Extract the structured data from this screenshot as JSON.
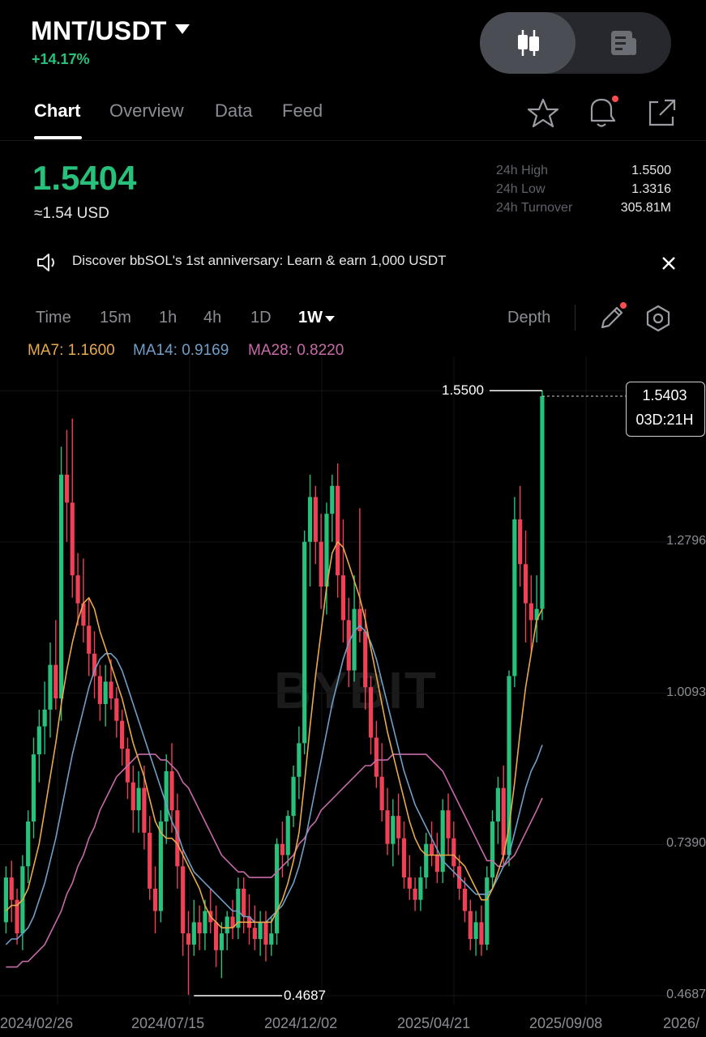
{
  "header": {
    "pair": "MNT/USDT",
    "change": "+14.17%",
    "view_toggle": {
      "chart_icon": "candlestick-icon",
      "list_icon": "document-icon",
      "active": "chart"
    }
  },
  "tabs": [
    {
      "label": "Chart",
      "active": true
    },
    {
      "label": "Overview",
      "active": false
    },
    {
      "label": "Data",
      "active": false
    },
    {
      "label": "Feed",
      "active": false
    }
  ],
  "header_actions": {
    "favorite": "star-icon",
    "alerts": "bell-icon",
    "share": "share-icon",
    "alert_dot_color": "#ff4d4f"
  },
  "ticker": {
    "last_price": "1.5404",
    "usd_value": "≈1.54 USD",
    "stats": [
      {
        "label": "24h High",
        "value": "1.5500"
      },
      {
        "label": "24h Low",
        "value": "1.3316"
      },
      {
        "label": "24h Turnover",
        "value": "305.81M"
      }
    ]
  },
  "banner": {
    "text": "Discover bbSOL's 1st anniversary: Learn & earn 1,000 USDT",
    "icon": "speaker-icon",
    "close_icon": "close-icon"
  },
  "timeframes": [
    {
      "label": "Time",
      "active": false
    },
    {
      "label": "15m",
      "active": false
    },
    {
      "label": "1h",
      "active": false
    },
    {
      "label": "4h",
      "active": false
    },
    {
      "label": "1D",
      "active": false
    },
    {
      "label": "1W",
      "active": true
    }
  ],
  "depth_label": "Depth",
  "tools": {
    "draw": "pencil-icon",
    "settings": "settings-icon"
  },
  "indicators": [
    {
      "label": "MA7: 1.1600",
      "color": "#e8a94b"
    },
    {
      "label": "MA14: 0.9169",
      "color": "#6f9fc9"
    },
    {
      "label": "MA28: 0.8220",
      "color": "#c76aa8"
    }
  ],
  "colors": {
    "up": "#27c17b",
    "down": "#ef4056"
  },
  "watermark": "BYBIT",
  "chart_data": {
    "type": "candlestick",
    "interval": "1W",
    "y_ticks": [
      "1.2796",
      "1.0093",
      "0.7390",
      "0.4687"
    ],
    "x_ticks": [
      "2024/02/26",
      "2024/07/15",
      "2024/12/02",
      "2025/04/21",
      "2025/09/08",
      "2026/"
    ],
    "high_marker": "1.5500",
    "low_marker": "0.4687",
    "last_price_label": "1.5403",
    "countdown": "03D:21H",
    "ohlc": [
      [
        0.6,
        0.7,
        0.58,
        0.68
      ],
      [
        0.68,
        0.71,
        0.6,
        0.64
      ],
      [
        0.64,
        0.66,
        0.56,
        0.58
      ],
      [
        0.58,
        0.72,
        0.55,
        0.7
      ],
      [
        0.7,
        0.8,
        0.67,
        0.78
      ],
      [
        0.78,
        0.93,
        0.75,
        0.9
      ],
      [
        0.9,
        0.98,
        0.85,
        0.95
      ],
      [
        0.95,
        1.03,
        0.9,
        0.98
      ],
      [
        0.98,
        1.1,
        0.93,
        1.06
      ],
      [
        1.06,
        1.14,
        0.98,
        1.0
      ],
      [
        1.0,
        1.45,
        0.96,
        1.4
      ],
      [
        1.4,
        1.48,
        1.28,
        1.35
      ],
      [
        1.35,
        1.5,
        1.18,
        1.22
      ],
      [
        1.22,
        1.26,
        1.13,
        1.17
      ],
      [
        1.17,
        1.25,
        1.1,
        1.13
      ],
      [
        1.13,
        1.18,
        1.04,
        1.08
      ],
      [
        1.08,
        1.12,
        1.0,
        1.04
      ],
      [
        1.04,
        1.06,
        0.96,
        0.99
      ],
      [
        0.99,
        1.06,
        0.95,
        1.03
      ],
      [
        1.03,
        1.07,
        0.98,
        1.0
      ],
      [
        1.0,
        1.02,
        0.93,
        0.96
      ],
      [
        0.96,
        0.98,
        0.88,
        0.91
      ],
      [
        0.91,
        0.93,
        0.82,
        0.85
      ],
      [
        0.85,
        0.88,
        0.76,
        0.8
      ],
      [
        0.8,
        0.87,
        0.76,
        0.84
      ],
      [
        0.84,
        0.88,
        0.73,
        0.76
      ],
      [
        0.76,
        0.79,
        0.64,
        0.66
      ],
      [
        0.66,
        0.7,
        0.58,
        0.62
      ],
      [
        0.62,
        0.8,
        0.6,
        0.78
      ],
      [
        0.78,
        0.9,
        0.74,
        0.87
      ],
      [
        0.87,
        0.92,
        0.76,
        0.8
      ],
      [
        0.8,
        0.83,
        0.66,
        0.7
      ],
      [
        0.7,
        0.73,
        0.54,
        0.58
      ],
      [
        0.58,
        0.62,
        0.47,
        0.56
      ],
      [
        0.56,
        0.64,
        0.54,
        0.6
      ],
      [
        0.6,
        0.63,
        0.55,
        0.58
      ],
      [
        0.58,
        0.64,
        0.55,
        0.62
      ],
      [
        0.62,
        0.66,
        0.58,
        0.6
      ],
      [
        0.6,
        0.63,
        0.52,
        0.55
      ],
      [
        0.55,
        0.6,
        0.5,
        0.58
      ],
      [
        0.58,
        0.62,
        0.55,
        0.61
      ],
      [
        0.61,
        0.64,
        0.57,
        0.59
      ],
      [
        0.59,
        0.68,
        0.57,
        0.66
      ],
      [
        0.66,
        0.68,
        0.58,
        0.61
      ],
      [
        0.61,
        0.65,
        0.56,
        0.59
      ],
      [
        0.59,
        0.63,
        0.55,
        0.57
      ],
      [
        0.57,
        0.62,
        0.54,
        0.6
      ],
      [
        0.6,
        0.62,
        0.53,
        0.56
      ],
      [
        0.56,
        0.61,
        0.54,
        0.58
      ],
      [
        0.58,
        0.75,
        0.56,
        0.74
      ],
      [
        0.74,
        0.78,
        0.68,
        0.72
      ],
      [
        0.72,
        0.8,
        0.7,
        0.79
      ],
      [
        0.79,
        0.88,
        0.77,
        0.86
      ],
      [
        0.86,
        0.95,
        0.82,
        0.92
      ],
      [
        0.92,
        1.3,
        0.9,
        1.28
      ],
      [
        1.28,
        1.4,
        1.2,
        1.36
      ],
      [
        1.36,
        1.38,
        1.24,
        1.28
      ],
      [
        1.28,
        1.33,
        1.16,
        1.2
      ],
      [
        1.2,
        1.35,
        1.15,
        1.33
      ],
      [
        1.33,
        1.4,
        1.28,
        1.38
      ],
      [
        1.38,
        1.42,
        1.18,
        1.22
      ],
      [
        1.22,
        1.32,
        1.1,
        1.14
      ],
      [
        1.14,
        1.18,
        1.02,
        1.05
      ],
      [
        1.05,
        1.22,
        1.03,
        1.16
      ],
      [
        1.16,
        1.34,
        1.1,
        1.12
      ],
      [
        1.12,
        1.16,
        0.98,
        1.02
      ],
      [
        1.02,
        1.04,
        0.9,
        0.93
      ],
      [
        0.93,
        0.96,
        0.84,
        0.86
      ],
      [
        0.86,
        0.92,
        0.78,
        0.8
      ],
      [
        0.8,
        0.84,
        0.72,
        0.74
      ],
      [
        0.74,
        0.82,
        0.7,
        0.79
      ],
      [
        0.79,
        0.83,
        0.72,
        0.75
      ],
      [
        0.75,
        0.78,
        0.66,
        0.68
      ],
      [
        0.68,
        0.72,
        0.64,
        0.66
      ],
      [
        0.66,
        0.68,
        0.62,
        0.64
      ],
      [
        0.64,
        0.7,
        0.62,
        0.68
      ],
      [
        0.68,
        0.76,
        0.66,
        0.74
      ],
      [
        0.74,
        0.78,
        0.7,
        0.72
      ],
      [
        0.72,
        0.76,
        0.67,
        0.69
      ],
      [
        0.69,
        0.82,
        0.67,
        0.8
      ],
      [
        0.8,
        0.83,
        0.72,
        0.75
      ],
      [
        0.75,
        0.78,
        0.68,
        0.7
      ],
      [
        0.7,
        0.72,
        0.64,
        0.66
      ],
      [
        0.66,
        0.68,
        0.6,
        0.62
      ],
      [
        0.62,
        0.64,
        0.55,
        0.57
      ],
      [
        0.57,
        0.62,
        0.54,
        0.6
      ],
      [
        0.6,
        0.63,
        0.54,
        0.56
      ],
      [
        0.56,
        0.7,
        0.55,
        0.68
      ],
      [
        0.68,
        0.8,
        0.66,
        0.78
      ],
      [
        0.78,
        0.86,
        0.74,
        0.84
      ],
      [
        0.84,
        0.88,
        0.7,
        0.72
      ],
      [
        0.72,
        1.05,
        0.7,
        1.04
      ],
      [
        1.04,
        1.36,
        1.02,
        1.32
      ],
      [
        1.32,
        1.38,
        1.2,
        1.24
      ],
      [
        1.24,
        1.3,
        1.1,
        1.17
      ],
      [
        1.17,
        1.22,
        1.08,
        1.14
      ],
      [
        1.14,
        1.22,
        1.1,
        1.16
      ],
      [
        1.16,
        1.55,
        1.14,
        1.5403
      ]
    ],
    "ma7": [
      0.62,
      0.63,
      0.63,
      0.64,
      0.66,
      0.7,
      0.74,
      0.8,
      0.86,
      0.92,
      0.99,
      1.05,
      1.1,
      1.14,
      1.17,
      1.18,
      1.16,
      1.12,
      1.09,
      1.06,
      1.03,
      1.0,
      0.96,
      0.92,
      0.89,
      0.86,
      0.82,
      0.78,
      0.76,
      0.75,
      0.75,
      0.74,
      0.72,
      0.7,
      0.68,
      0.66,
      0.63,
      0.61,
      0.6,
      0.59,
      0.59,
      0.59,
      0.6,
      0.6,
      0.6,
      0.6,
      0.6,
      0.6,
      0.6,
      0.62,
      0.64,
      0.67,
      0.71,
      0.76,
      0.85,
      0.95,
      1.04,
      1.12,
      1.2,
      1.26,
      1.28,
      1.27,
      1.24,
      1.21,
      1.18,
      1.14,
      1.09,
      1.04,
      0.99,
      0.94,
      0.9,
      0.86,
      0.82,
      0.78,
      0.75,
      0.73,
      0.72,
      0.72,
      0.72,
      0.72,
      0.72,
      0.72,
      0.71,
      0.7,
      0.68,
      0.66,
      0.64,
      0.64,
      0.66,
      0.69,
      0.72,
      0.77,
      0.85,
      0.94,
      1.02,
      1.08,
      1.14,
      1.16
    ],
    "ma14": [
      0.56,
      0.57,
      0.57,
      0.58,
      0.59,
      0.61,
      0.64,
      0.67,
      0.71,
      0.75,
      0.8,
      0.85,
      0.9,
      0.94,
      0.98,
      1.02,
      1.05,
      1.07,
      1.08,
      1.08,
      1.07,
      1.05,
      1.02,
      0.99,
      0.96,
      0.93,
      0.9,
      0.87,
      0.84,
      0.81,
      0.78,
      0.76,
      0.73,
      0.71,
      0.69,
      0.68,
      0.67,
      0.66,
      0.65,
      0.64,
      0.63,
      0.62,
      0.62,
      0.61,
      0.61,
      0.6,
      0.6,
      0.6,
      0.61,
      0.62,
      0.63,
      0.65,
      0.67,
      0.7,
      0.74,
      0.79,
      0.84,
      0.89,
      0.94,
      0.99,
      1.03,
      1.07,
      1.1,
      1.12,
      1.13,
      1.12,
      1.1,
      1.07,
      1.03,
      0.99,
      0.95,
      0.91,
      0.87,
      0.84,
      0.81,
      0.79,
      0.77,
      0.75,
      0.73,
      0.71,
      0.7,
      0.69,
      0.68,
      0.67,
      0.66,
      0.65,
      0.65,
      0.65,
      0.66,
      0.68,
      0.7,
      0.72,
      0.76,
      0.8,
      0.84,
      0.87,
      0.89,
      0.9169
    ],
    "ma28": [
      0.52,
      0.52,
      0.52,
      0.53,
      0.53,
      0.54,
      0.55,
      0.56,
      0.58,
      0.6,
      0.62,
      0.65,
      0.67,
      0.7,
      0.72,
      0.75,
      0.77,
      0.8,
      0.82,
      0.84,
      0.86,
      0.87,
      0.88,
      0.89,
      0.9,
      0.9,
      0.9,
      0.9,
      0.89,
      0.89,
      0.88,
      0.87,
      0.85,
      0.84,
      0.82,
      0.8,
      0.78,
      0.76,
      0.74,
      0.72,
      0.71,
      0.7,
      0.69,
      0.69,
      0.68,
      0.68,
      0.68,
      0.68,
      0.68,
      0.69,
      0.7,
      0.71,
      0.72,
      0.74,
      0.75,
      0.77,
      0.78,
      0.8,
      0.81,
      0.82,
      0.83,
      0.84,
      0.85,
      0.86,
      0.87,
      0.88,
      0.88,
      0.89,
      0.89,
      0.89,
      0.9,
      0.9,
      0.9,
      0.9,
      0.9,
      0.9,
      0.9,
      0.89,
      0.88,
      0.87,
      0.85,
      0.83,
      0.81,
      0.79,
      0.77,
      0.75,
      0.73,
      0.71,
      0.71,
      0.7,
      0.7,
      0.71,
      0.72,
      0.74,
      0.76,
      0.78,
      0.8,
      0.822
    ]
  }
}
